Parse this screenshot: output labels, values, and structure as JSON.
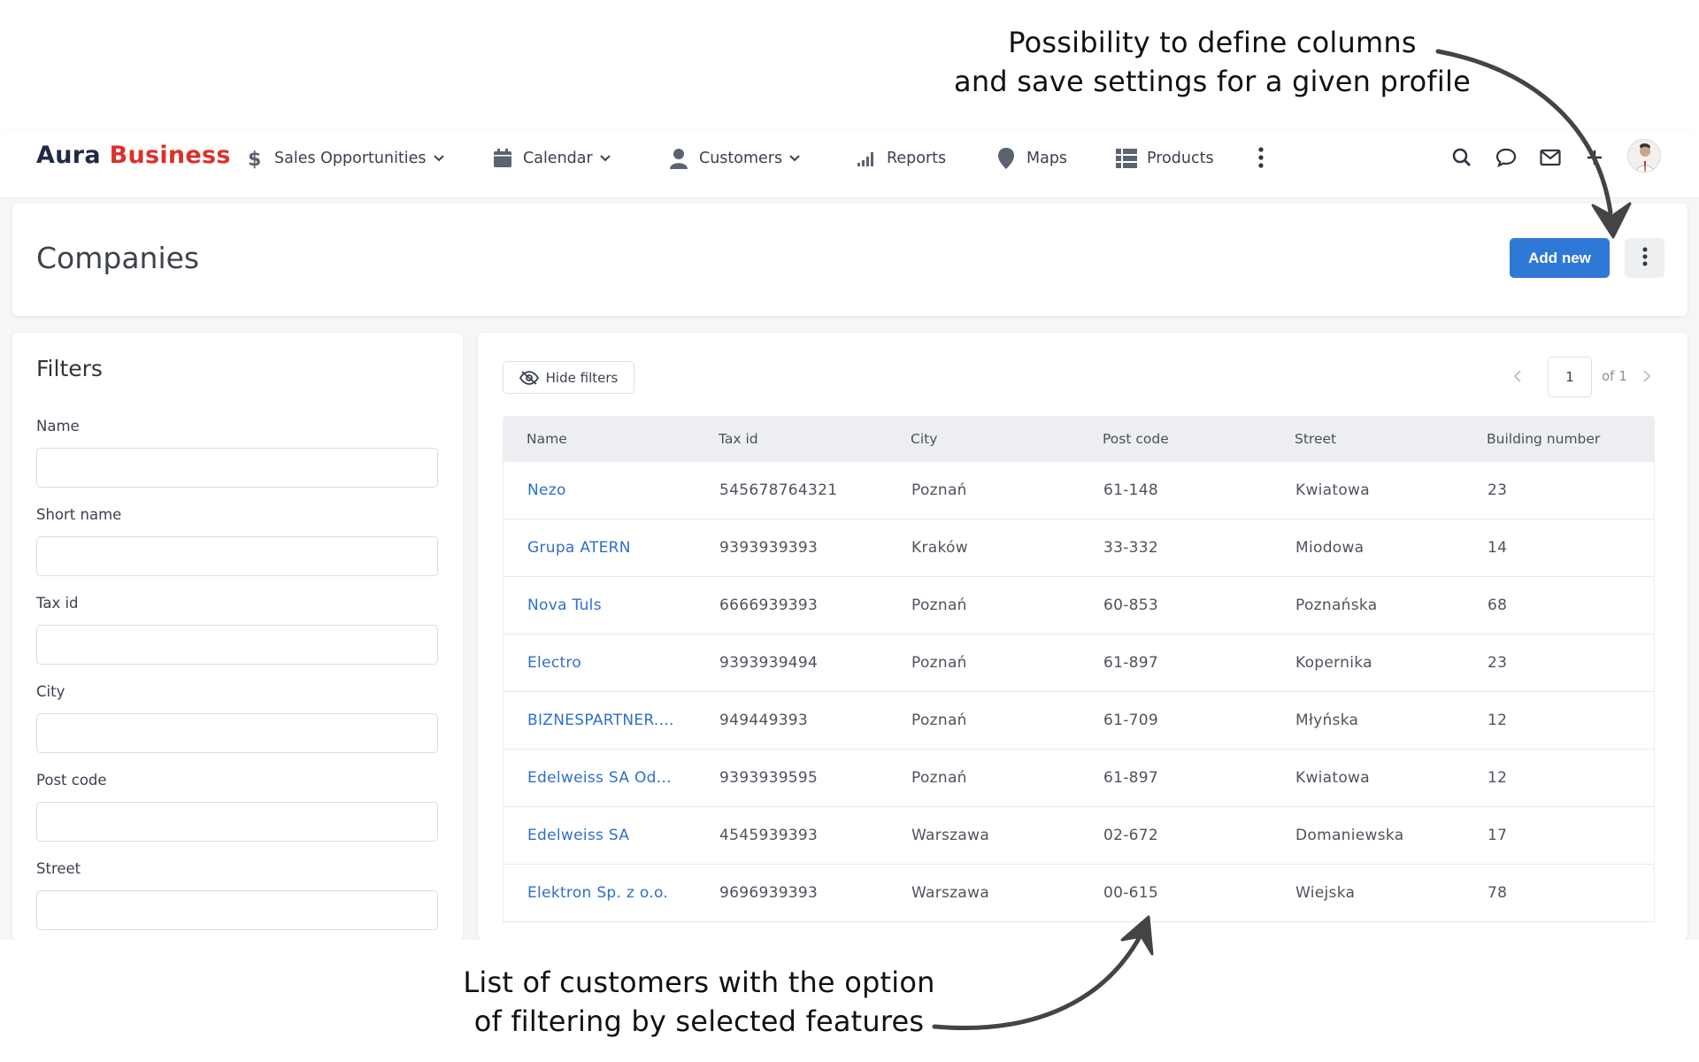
{
  "annotations": {
    "top_line1": "Possibility to define columns",
    "top_line2": "and save settings for a given profile",
    "bottom_line1": "List of customers with the option",
    "bottom_line2": "of filtering by selected features"
  },
  "topbar": {
    "logo_part1": "Aura",
    "logo_part2": "Business",
    "nav": [
      {
        "label": "Sales Opportunities",
        "icon": "dollar-icon",
        "dropdown": true
      },
      {
        "label": "Calendar",
        "icon": "calendar-icon",
        "dropdown": true
      },
      {
        "label": "Customers",
        "icon": "person-icon",
        "dropdown": true
      },
      {
        "label": "Reports",
        "icon": "bar-chart-icon",
        "dropdown": false
      },
      {
        "label": "Maps",
        "icon": "map-pin-icon",
        "dropdown": false
      },
      {
        "label": "Products",
        "icon": "grid-list-icon",
        "dropdown": false
      }
    ],
    "right_icons": [
      "search-icon",
      "chat-icon",
      "mail-icon",
      "plus-icon",
      "avatar"
    ]
  },
  "header": {
    "title": "Companies",
    "add_button": "Add new"
  },
  "filters": {
    "title": "Filters",
    "fields": [
      {
        "label": "Name",
        "value": ""
      },
      {
        "label": "Short name",
        "value": ""
      },
      {
        "label": "Tax id",
        "value": ""
      },
      {
        "label": "City",
        "value": ""
      },
      {
        "label": "Post code",
        "value": ""
      },
      {
        "label": "Street",
        "value": ""
      }
    ]
  },
  "table": {
    "hide_filters_label": "Hide filters",
    "pager": {
      "page": "1",
      "of_label": "of 1"
    },
    "columns": [
      "Name",
      "Tax id",
      "City",
      "Post code",
      "Street",
      "Building number"
    ],
    "rows": [
      [
        "Nezo",
        "545678764321",
        "Poznań",
        "61-148",
        "Kwiatowa",
        "23"
      ],
      [
        "Grupa ATERN",
        "9393939393",
        "Kraków",
        "33-332",
        "Miodowa",
        "14"
      ],
      [
        "Nova Tuls",
        "6666939393",
        "Poznań",
        "60-853",
        "Poznańska",
        "68"
      ],
      [
        "Electro",
        "9393939494",
        "Poznań",
        "61-897",
        "Kopernika",
        "23"
      ],
      [
        "BIZNESPARTNER....",
        "949449393",
        "Poznań",
        "61-709",
        "Młyńska",
        "12"
      ],
      [
        "Edelweiss SA Od...",
        "9393939595",
        "Poznań",
        "61-897",
        "Kwiatowa",
        "12"
      ],
      [
        "Edelweiss SA",
        "4545939393",
        "Warszawa",
        "02-672",
        "Domaniewska",
        "17"
      ],
      [
        "Elektron Sp. z o.o.",
        "9696939393",
        "Warszawa",
        "00-615",
        "Wiejska",
        "78"
      ]
    ]
  },
  "colors": {
    "brand_dark": "#1f2a44",
    "brand_red": "#d9322b",
    "accent_blue": "#2f79d6",
    "link_blue": "#2f6fc9"
  }
}
